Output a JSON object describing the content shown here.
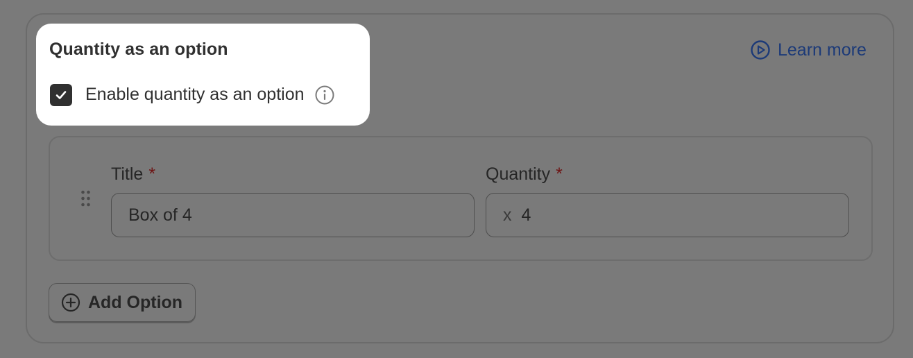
{
  "section": {
    "title": "Quantity as an option",
    "checkbox_label": "Enable quantity as an option",
    "checkbox_checked": true
  },
  "learn_more": {
    "label": "Learn more",
    "icon": "play-circle-icon",
    "color": "#1c3a78"
  },
  "option": {
    "title_label": "Title",
    "title_value": "Box of 4",
    "quantity_label": "Quantity",
    "quantity_prefix": "x",
    "quantity_value": "4",
    "required_mark": "*"
  },
  "add_option": {
    "label": "Add Option",
    "icon": "plus-circle-icon"
  },
  "colors": {
    "overlay": "#7a7a7a",
    "spotlight": "#ffffff",
    "required": "#6e1414"
  }
}
